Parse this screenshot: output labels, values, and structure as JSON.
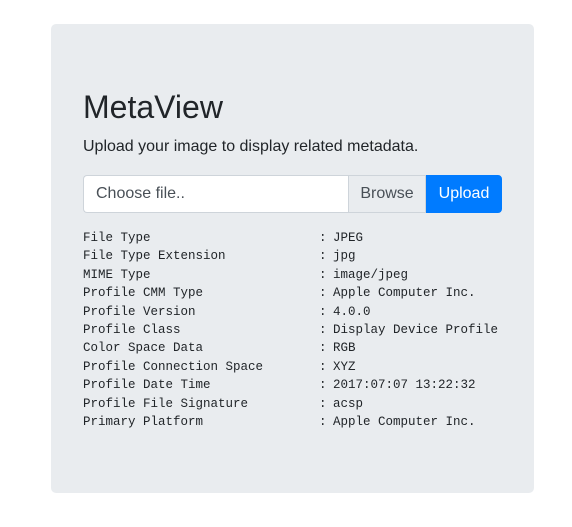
{
  "app": {
    "title": "MetaView",
    "subtitle": "Upload your image to display related metadata."
  },
  "upload": {
    "file_placeholder": "Choose file..",
    "browse_label": "Browse",
    "upload_label": "Upload"
  },
  "metadata": [
    {
      "key": "File Type",
      "value": "JPEG"
    },
    {
      "key": "File Type Extension",
      "value": "jpg"
    },
    {
      "key": "MIME Type",
      "value": "image/jpeg"
    },
    {
      "key": "Profile CMM Type",
      "value": "Apple Computer Inc."
    },
    {
      "key": "Profile Version",
      "value": "4.0.0"
    },
    {
      "key": "Profile Class",
      "value": "Display Device Profile"
    },
    {
      "key": "Color Space Data",
      "value": "RGB"
    },
    {
      "key": "Profile Connection Space",
      "value": "XYZ"
    },
    {
      "key": "Profile Date Time",
      "value": "2017:07:07 13:22:32"
    },
    {
      "key": "Profile File Signature",
      "value": "acsp"
    },
    {
      "key": "Primary Platform",
      "value": "Apple Computer Inc."
    }
  ],
  "separator": ":",
  "colors": {
    "panel_bg": "#e9ecef",
    "primary": "#007bff"
  }
}
